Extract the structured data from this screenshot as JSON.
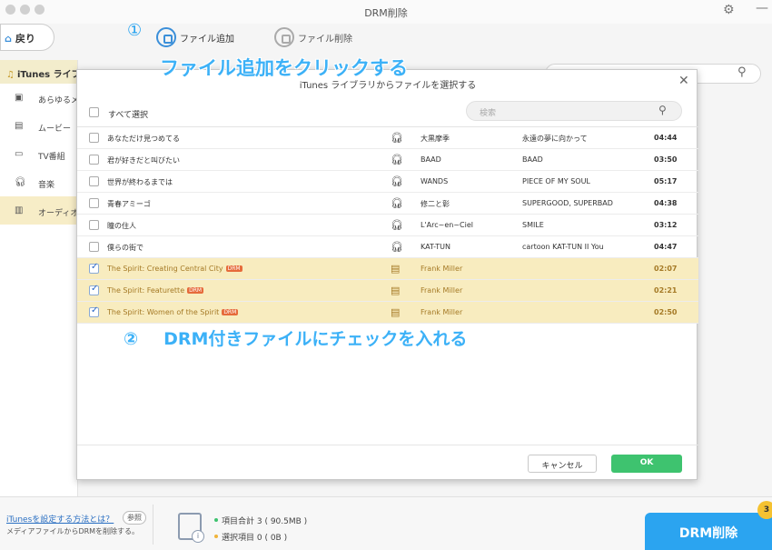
{
  "window": {
    "title": "DRM削除"
  },
  "toolbar": {
    "back_label": "戻り",
    "step1_marker": "①",
    "add_file_label": "ファイル追加",
    "delete_file_label": "ファイル削除",
    "annotation1": "ファイル追加をクリックする"
  },
  "sidebar": {
    "header": "iTunes ライブラリ",
    "items": [
      {
        "label": "あらゆるメディア"
      },
      {
        "label": "ムービー"
      },
      {
        "label": "TV番組"
      },
      {
        "label": "音楽"
      },
      {
        "label": "オーディオブック"
      }
    ]
  },
  "dialog": {
    "title": "iTunes ライブラリからファイルを選択する",
    "select_all_label": "すべて選択",
    "search_placeholder": "検索",
    "drm_tag": "DRM",
    "rows": [
      {
        "title": "あなただけ見つめてる",
        "artist": "大黒摩季",
        "album": "永遠の夢に向かって",
        "duration": "04:44",
        "checked": false,
        "drm": false
      },
      {
        "title": "君が好きだと叫びたい",
        "artist": "BAAD",
        "album": "BAAD",
        "duration": "03:50",
        "checked": false,
        "drm": false
      },
      {
        "title": "世界が終わるまでは",
        "artist": "WANDS",
        "album": "PIECE OF MY SOUL",
        "duration": "05:17",
        "checked": false,
        "drm": false
      },
      {
        "title": "青春アミーゴ",
        "artist": "修二と彰",
        "album": "SUPERGOOD, SUPERBAD",
        "duration": "04:38",
        "checked": false,
        "drm": false
      },
      {
        "title": "瞳の住人",
        "artist": "L'Arc~en~Ciel",
        "album": "SMILE",
        "duration": "03:12",
        "checked": false,
        "drm": false
      },
      {
        "title": "僕らの街で",
        "artist": "KAT-TUN",
        "album": "cartoon KAT-TUN II You",
        "duration": "04:47",
        "checked": false,
        "drm": false
      },
      {
        "title": "The Spirit: Creating Central City",
        "artist": "Frank Miller",
        "album": "",
        "duration": "02:07",
        "checked": true,
        "drm": true
      },
      {
        "title": "The Spirit: Featurette",
        "artist": "Frank Miller",
        "album": "",
        "duration": "02:21",
        "checked": true,
        "drm": true
      },
      {
        "title": "The Spirit: Women of the Spirit",
        "artist": "Frank Miller",
        "album": "",
        "duration": "02:50",
        "checked": true,
        "drm": true
      }
    ],
    "annotation2_number": "②",
    "annotation2_text": "DRM付きファイルにチェックを入れる",
    "cancel_label": "キャンセル",
    "ok_label": "OK"
  },
  "bottom": {
    "help_link": "iTunesを設定する方法とは？",
    "help_ref": "参照",
    "help_sub": "メディアファイルからDRMを削除する。",
    "stat_total": "項目合計 3 ( 90.5MB )",
    "stat_selected": "選択項目 0 ( 0B )",
    "drm_button": "DRM削除",
    "step3_marker": "3"
  },
  "colors": {
    "accent_blue": "#2ba4f0",
    "annotation_blue": "#3cb1f7",
    "ok_green": "#3ec36f",
    "drm_row_bg": "#f8ecbf",
    "drm_text": "#a57a26",
    "drm_tag": "#e66b3b"
  }
}
